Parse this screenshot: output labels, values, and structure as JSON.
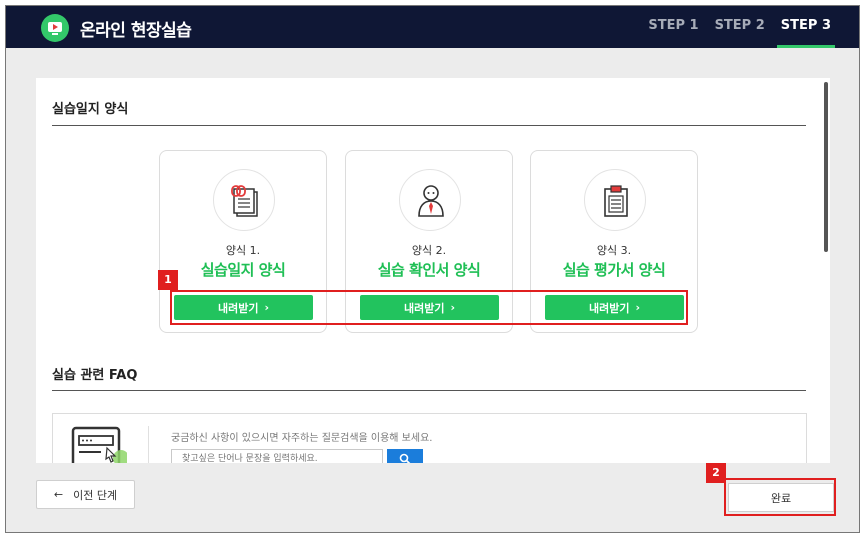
{
  "header": {
    "title": "온라인 현장실습",
    "steps": [
      "STEP 1",
      "STEP 2",
      "STEP 3"
    ],
    "active_step": 2,
    "accent_color": "#33c86a"
  },
  "section_forms": {
    "title": "실습일지 양식",
    "cards": [
      {
        "label": "양식 1.",
        "title": "실습일지 양식",
        "button": "내려받기",
        "icon": "document-clip-icon"
      },
      {
        "label": "양식 2.",
        "title": "실습 확인서 양식",
        "button": "내려받기",
        "icon": "person-tie-icon"
      },
      {
        "label": "양식 3.",
        "title": "실습 평가서 양식",
        "button": "내려받기",
        "icon": "clipboard-icon"
      }
    ]
  },
  "section_faq": {
    "title": "실습 관련 FAQ",
    "description": "궁금하신 사항이 있으시면 자주하는 질문검색을 이용해 보세요.",
    "search_placeholder": "찾고싶은 단어나 문장을 입력하세요."
  },
  "annotations": [
    "1",
    "2"
  ],
  "footer": {
    "prev_label": "이전 단계",
    "done_label": "완료"
  }
}
